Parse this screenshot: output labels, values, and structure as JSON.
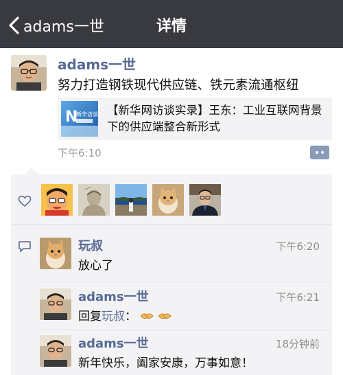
{
  "nav": {
    "back_label": "adams一世",
    "title": "详情"
  },
  "post": {
    "author": "adams一世",
    "text": "努力打造钢铁现代供应链、铁元素流通枢纽",
    "share": {
      "title": "【新华网访谈实录】王东：工业互联网背景下的供应端整合新形式",
      "thumb_text": "新华访谈"
    },
    "time": "下午6:10"
  },
  "likes": {
    "icon": "heart-icon",
    "users": [
      "avatar-1",
      "avatar-2",
      "avatar-3",
      "avatar-4",
      "avatar-5"
    ]
  },
  "comments": [
    {
      "author": "玩叔",
      "time": "下午6:20",
      "text": "放心了"
    },
    {
      "author": "adams一世",
      "time": "下午6:21",
      "reply_prefix": "回复",
      "reply_to": "玩叔",
      "reply_suffix": "："
    },
    {
      "author": "adams一世",
      "time": "18分钟前",
      "text": "新年快乐，阖家安康，万事如意！"
    }
  ],
  "colors": {
    "navbar": "#393a3f",
    "link": "#576b95",
    "panel": "#f3f3f5"
  }
}
